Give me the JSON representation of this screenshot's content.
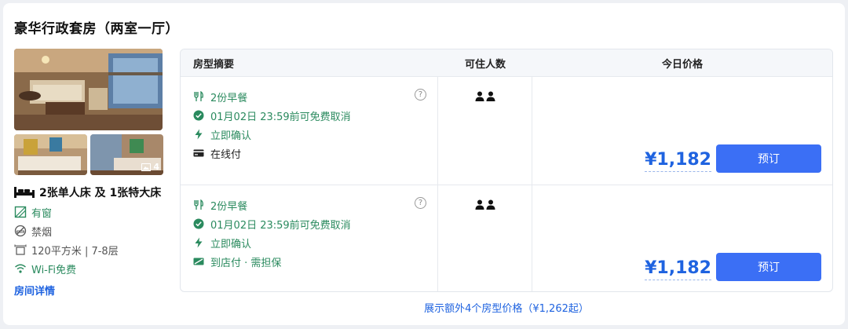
{
  "room": {
    "title": "豪华行政套房（两室一厅）",
    "photo_count": "4",
    "bed": "2张单人床 及 1张特大床",
    "features": [
      {
        "icon": "window-icon",
        "label": "有窗"
      },
      {
        "icon": "no-smoking-icon",
        "label": "禁烟"
      },
      {
        "icon": "area-icon",
        "label": "120平方米 | 7-8层"
      },
      {
        "icon": "wifi-icon",
        "label": "Wi-Fi免费"
      }
    ],
    "detail_link": "房间详情"
  },
  "table": {
    "headers": {
      "summary": "房型摘要",
      "occupancy": "可住人数",
      "price": "今日价格"
    },
    "rows": [
      {
        "breakfast": "2份早餐",
        "cancel": "01月02日 23:59前可免费取消",
        "confirm": "立即确认",
        "payment": "在线付",
        "guests": 2,
        "price": "¥1,182",
        "book_label": "预订"
      },
      {
        "breakfast": "2份早餐",
        "cancel": "01月02日 23:59前可免费取消",
        "confirm": "立即确认",
        "payment": "到店付 · 需担保",
        "guests": 2,
        "price": "¥1,182",
        "book_label": "预订"
      }
    ],
    "help_symbol": "?"
  },
  "more_rates": "展示额外4个房型价格（¥1,262起）",
  "colors": {
    "accent": "#1f63e0",
    "button": "#3b6ff5",
    "green": "#2a8a5e"
  }
}
